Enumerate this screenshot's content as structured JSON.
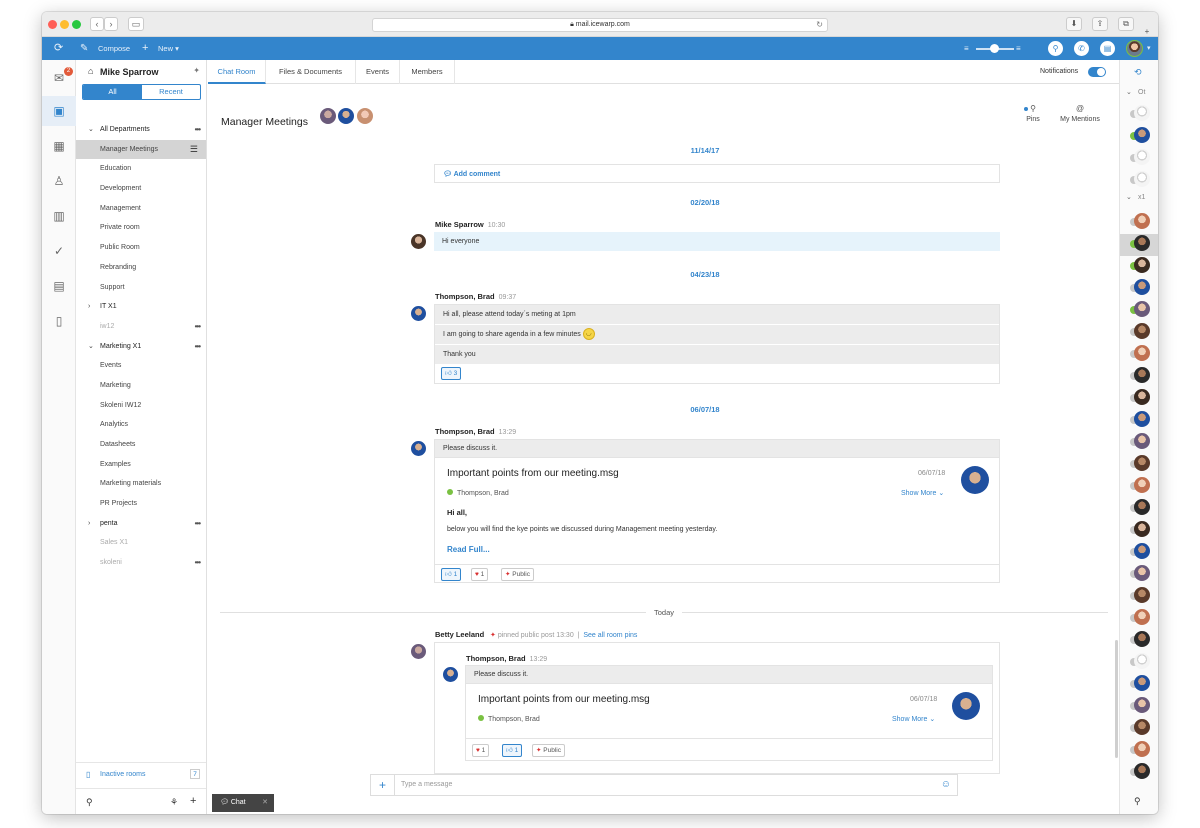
{
  "browser": {
    "url": "mail.icewarp.com"
  },
  "topbar": {
    "compose_label": "Compose",
    "new_label": "New"
  },
  "rail": {
    "mail_badge": "2"
  },
  "sidebar": {
    "user_name": "Mike Sparrow",
    "filter_all": "All",
    "filter_recent": "Recent",
    "rows": [
      {
        "label": "All Departments",
        "type": "group",
        "caret": "open",
        "dots": true
      },
      {
        "label": "Manager Meetings",
        "type": "item",
        "selected": true,
        "menu": true
      },
      {
        "label": "Education",
        "type": "item"
      },
      {
        "label": "Development",
        "type": "item"
      },
      {
        "label": "Management",
        "type": "item"
      },
      {
        "label": "Private room",
        "type": "item"
      },
      {
        "label": "Public Room",
        "type": "item"
      },
      {
        "label": "Rebranding",
        "type": "item"
      },
      {
        "label": "Support",
        "type": "item"
      },
      {
        "label": "IT X1",
        "type": "group",
        "caret": "closed"
      },
      {
        "label": "iw12",
        "type": "muted",
        "dots": true
      },
      {
        "label": "Marketing X1",
        "type": "group",
        "caret": "open",
        "dots": true
      },
      {
        "label": "Events",
        "type": "item"
      },
      {
        "label": "Marketing",
        "type": "item"
      },
      {
        "label": "Skoleni IW12",
        "type": "item"
      },
      {
        "label": "Analytics",
        "type": "item"
      },
      {
        "label": "Datasheets",
        "type": "item"
      },
      {
        "label": "Examples",
        "type": "item"
      },
      {
        "label": "Marketing materials",
        "type": "item"
      },
      {
        "label": "PR Projects",
        "type": "item"
      },
      {
        "label": "penta",
        "type": "group",
        "caret": "closed",
        "dots": true
      },
      {
        "label": "Sales X1",
        "type": "muted"
      },
      {
        "label": "skoleni",
        "type": "muted",
        "dots": true
      }
    ],
    "inactive_rooms_label": "Inactive rooms",
    "inactive_rooms_count": "7"
  },
  "tabs": [
    "Chat Room",
    "Files & Documents",
    "Events",
    "Members"
  ],
  "notifications_label": "Notifications",
  "room": {
    "title": "Manager Meetings",
    "pins_label": "Pins",
    "mentions_label": "My Mentions"
  },
  "chat": {
    "date1": "11/14/17",
    "add_comment": "Add comment",
    "date2": "02/20/18",
    "msg1_sender": "Mike Sparrow",
    "msg1_time": "10:30",
    "msg1_text": "Hi everyone",
    "date3": "04/23/18",
    "msg2_sender": "Thompson, Brad",
    "msg2_time": "09:37",
    "msg2_lines": [
      "Hi all, please attend today´s meting at 1pm",
      "I am going to share agenda in a few minutes",
      "Thank you"
    ],
    "msg2_like_count": "3",
    "date4": "06/07/18",
    "msg3_sender": "Thompson, Brad",
    "msg3_time": "13:29",
    "msg3_text": "Please discuss it.",
    "attach_title": "Important points from our meeting.msg",
    "attach_date": "06/07/18",
    "attach_from": "Thompson, Brad",
    "show_more": "Show More",
    "body_greeting": "Hi all,",
    "body_text": "below you will find the kye points we discussed during  Management meeting yesterday.",
    "read_full": "Read Full...",
    "msg3_like_count": "1",
    "msg3_heart_count": "1",
    "public_label": "Public",
    "today_label": "Today",
    "pin_sender": "Betty Leeland",
    "pin_note": "pinned public post 13:30",
    "see_all_pins": "See all room pins",
    "pin_inner_sender": "Thompson, Brad",
    "pin_inner_time": "13:29",
    "pin_inner_text": "Please discuss it.",
    "pin_heart_count": "1",
    "pin_like_count": "1"
  },
  "composer": {
    "placeholder": "Type a message"
  },
  "dock": {
    "chat_label": "Chat"
  },
  "contacts": {
    "group1_label": "Ot",
    "group2_label": "x1"
  },
  "colors": {
    "accent": "#3385cc",
    "online": "#7ac142"
  }
}
